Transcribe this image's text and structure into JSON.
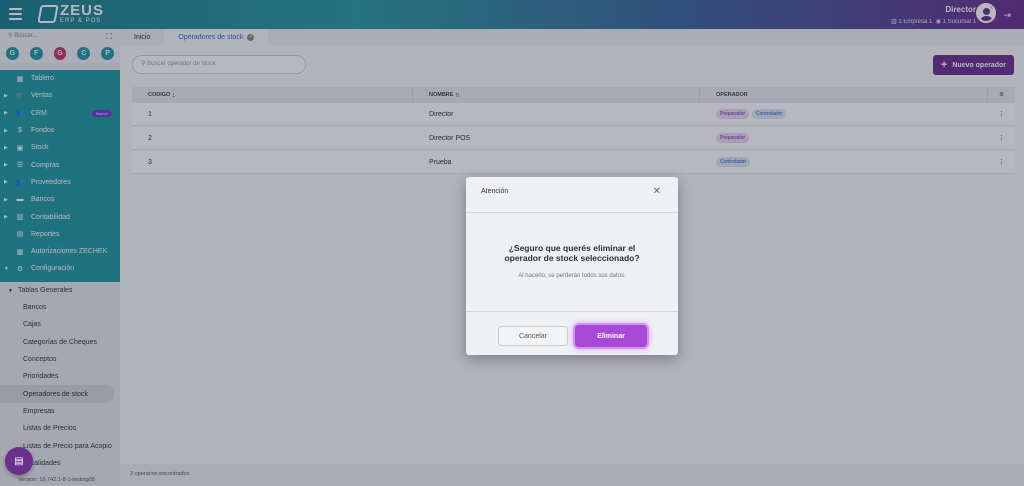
{
  "topbar": {
    "brand": "ZEUS",
    "brand_sub": "ERP & POS",
    "user_name": "Director",
    "empresa": "1 Empresa 1",
    "sucursal": "1 Sucursal 1"
  },
  "sidebar": {
    "search_placeholder": "Buscar...",
    "favorites": [
      {
        "letter": "G",
        "color": "#1f9aa0"
      },
      {
        "letter": "F",
        "color": "#1f9aa0"
      },
      {
        "letter": "G",
        "color": "#c2366b"
      },
      {
        "letter": "C",
        "color": "#1f9aa0"
      },
      {
        "letter": "P",
        "color": "#1f9aa0"
      }
    ],
    "items": [
      {
        "label": "Tablero",
        "icon": "dashboard-icon",
        "glyph": "▦"
      },
      {
        "label": "Ventas",
        "icon": "cart-icon",
        "glyph": "🛒"
      },
      {
        "label": "CRM",
        "icon": "people-icon",
        "glyph": "👥",
        "badge": "Nuevo"
      },
      {
        "label": "Fondos",
        "icon": "dollar-icon",
        "glyph": "$"
      },
      {
        "label": "Stock",
        "icon": "box-icon",
        "glyph": "▣"
      },
      {
        "label": "Compras",
        "icon": "receipt-icon",
        "glyph": "☰"
      },
      {
        "label": "Proveedores",
        "icon": "suppliers-icon",
        "glyph": "👥"
      },
      {
        "label": "Bancos",
        "icon": "briefcase-icon",
        "glyph": "▬"
      },
      {
        "label": "Contabilidad",
        "icon": "book-icon",
        "glyph": "▥"
      },
      {
        "label": "Reportes",
        "icon": "report-icon",
        "glyph": "▤"
      },
      {
        "label": "Autorizaciones ZECHEK",
        "icon": "check-icon",
        "glyph": "▦"
      },
      {
        "label": "Configuración",
        "icon": "settings-icon",
        "glyph": "⚙"
      }
    ],
    "group_label": "Tablas Generales",
    "sub_items": [
      "Bancos",
      "Cajas",
      "Categorías de Cheques",
      "Conceptos",
      "Prioridades",
      "Operadores de stock",
      "Empresas",
      "Listas de Precios",
      "Listas de Precio para Acopio",
      "Localidades"
    ],
    "active_sub": "Operadores de stock",
    "version": "Versión: 15.742.1-8-1-testing08"
  },
  "tabs": [
    {
      "label": "Inicio"
    },
    {
      "label": "Operadores de stock"
    }
  ],
  "main": {
    "search_placeholder": "Buscar operador de stock",
    "new_button": "Nuevo operador",
    "columns": [
      "CODIGO",
      "NOMBRE",
      "OPERADOR"
    ],
    "rows": [
      {
        "code": "1",
        "name": "Director",
        "roles": [
          "Preparador",
          "Controlador"
        ]
      },
      {
        "code": "2",
        "name": "Director POS",
        "roles": [
          "Preparador"
        ]
      },
      {
        "code": "3",
        "name": "Prueba",
        "roles": [
          "Controlador"
        ]
      }
    ],
    "footer_count": "3 operarios encontrados"
  },
  "modal": {
    "header": "Atención",
    "title": "¿Seguro que querés eliminar el operador de stock seleccionado?",
    "description": "Al hacerlo, se perderán todos sus datos.",
    "cancel": "Cancelar",
    "confirm": "Eliminar"
  },
  "colors": {
    "primary": "#6b2f8e",
    "teal": "#1f9aa0",
    "delete": "#a64ad6"
  }
}
